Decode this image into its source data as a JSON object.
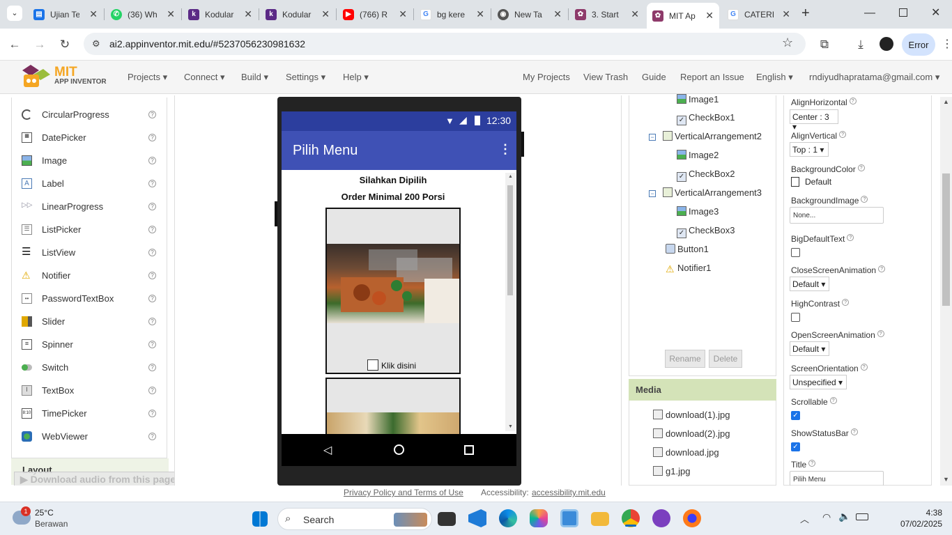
{
  "browser": {
    "tabs": [
      {
        "title": "Ujian Te",
        "favicon": "form-icon",
        "color": "#1a73e8"
      },
      {
        "title": "(36) Wh",
        "favicon": "whatsapp-icon",
        "color": "#25d366"
      },
      {
        "title": "Kodular",
        "favicon": "kodular-icon",
        "color": "#5b2a86"
      },
      {
        "title": "Kodular",
        "favicon": "kodular-icon",
        "color": "#5b2a86"
      },
      {
        "title": "(766) R",
        "favicon": "youtube-icon",
        "color": "#ff0000"
      },
      {
        "title": "bg kere",
        "favicon": "google-icon",
        "color": "#4285f4"
      },
      {
        "title": "New Ta",
        "favicon": "chrome-icon",
        "color": "#555555"
      },
      {
        "title": "3. Start",
        "favicon": "mit-icon",
        "color": "#8e3a6a"
      },
      {
        "title": "MIT Ap",
        "favicon": "mit-icon",
        "color": "#8e3a6a"
      },
      {
        "title": "CATERI",
        "favicon": "google-icon",
        "color": "#4285f4"
      }
    ],
    "url": "ai2.appinventor.mit.edu/#5237056230981632",
    "profile_button": "Error"
  },
  "app_header": {
    "logo_line1": "MIT",
    "logo_line2": "APP INVENTOR",
    "menus": [
      "Projects",
      "Connect",
      "Build",
      "Settings",
      "Help"
    ],
    "links": [
      "My Projects",
      "View Trash",
      "Guide",
      "Report an Issue"
    ],
    "language": "English",
    "account": "rndiyudhapratama@gmail.com"
  },
  "palette": {
    "items": [
      "CircularProgress",
      "DatePicker",
      "Image",
      "Label",
      "LinearProgress",
      "ListPicker",
      "ListView",
      "Notifier",
      "PasswordTextBox",
      "Slider",
      "Spinner",
      "Switch",
      "TextBox",
      "TimePicker",
      "WebViewer"
    ],
    "section": "Layout",
    "help": "?"
  },
  "download_bar": "Download audio from this page",
  "phone": {
    "time": "12:30",
    "title": "Pilih Menu",
    "label1": "Silahkan Dipilih",
    "label2": "Order Minimal 200 Porsi",
    "checkbox_label": "Klik disini"
  },
  "tree": {
    "nodes": [
      "Image1",
      "CheckBox1",
      "VerticalArrangement2",
      "Image2",
      "CheckBox2",
      "VerticalArrangement3",
      "Image3",
      "CheckBox3",
      "Button1",
      "Notifier1"
    ],
    "rename": "Rename",
    "delete": "Delete"
  },
  "media": {
    "title": "Media",
    "files": [
      "download(1).jpg",
      "download(2).jpg",
      "download.jpg",
      "g1.jpg"
    ]
  },
  "properties": {
    "AlignHorizontal": {
      "label": "AlignHorizontal",
      "value": "Center : 3"
    },
    "AlignVertical": {
      "label": "AlignVertical",
      "value": "Top : 1"
    },
    "BackgroundColor": {
      "label": "BackgroundColor",
      "value": "Default"
    },
    "BackgroundImage": {
      "label": "BackgroundImage",
      "value": "None..."
    },
    "BigDefaultText": {
      "label": "BigDefaultText",
      "checked": false
    },
    "CloseScreenAnimation": {
      "label": "CloseScreenAnimation",
      "value": "Default"
    },
    "HighContrast": {
      "label": "HighContrast",
      "checked": false
    },
    "OpenScreenAnimation": {
      "label": "OpenScreenAnimation",
      "value": "Default"
    },
    "ScreenOrientation": {
      "label": "ScreenOrientation",
      "value": "Unspecified"
    },
    "Scrollable": {
      "label": "Scrollable",
      "checked": true
    },
    "ShowStatusBar": {
      "label": "ShowStatusBar",
      "checked": true
    },
    "Title": {
      "label": "Title",
      "value": "Pilih Menu"
    }
  },
  "footer": {
    "privacy": "Privacy Policy and Terms of Use",
    "accessibility_label": "Accessibility:",
    "accessibility_link": "accessibility.mit.edu"
  },
  "taskbar": {
    "temp": "25°C",
    "weather": "Berawan",
    "badge": "1",
    "search": "Search",
    "time": "4:38",
    "date": "07/02/2025"
  },
  "colors": {
    "accent": "#3f51b5",
    "status": "#2c3e9e",
    "media_header": "#d4e3b8"
  }
}
